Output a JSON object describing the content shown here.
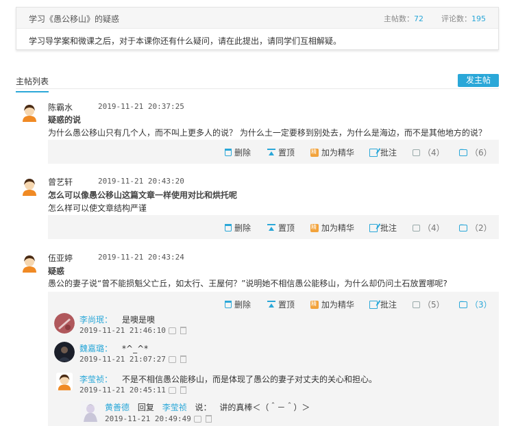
{
  "topic": {
    "title": "学习《愚公移山》的疑惑",
    "main_posts_label": "主帖数：",
    "main_posts_count": "72",
    "comments_label": "评论数：",
    "comments_count": "195",
    "description": "学习导学案和微课之后，对于本课你还有什么疑问，请在此提出，请同学们互相解疑。"
  },
  "list": {
    "tab_label": "主帖列表",
    "new_post_label": "发主帖"
  },
  "actions": {
    "delete": "删除",
    "pin": "置顶",
    "feature": "加为精华",
    "annotate": "批注"
  },
  "posts": [
    {
      "author": "陈霸水",
      "time": "2019-11-21 20:37:25",
      "title": "疑惑的说",
      "body": "为什么愚公移山只有几个人，而不叫上更多人的说？ 为什么土一定要移到别处去，为什么是海边，而不是其他地方的说？",
      "likes": "（4）",
      "replies": "（6）"
    },
    {
      "author": "曾艺轩",
      "time": "2019-11-21 20:43:20",
      "title": "怎么可以像愚公移山这篇文章一样使用对比和烘托呢",
      "body": "怎么样可以使文章结构严谨",
      "likes": "（4）",
      "replies": "（2）"
    },
    {
      "author": "伍亚婷",
      "time": "2019-11-21 20:43:24",
      "title": "疑惑",
      "body": "愚公的妻子说“曾不能损魁父亡丘，如太行、王屋何？”说明她不相信愚公能移山，为什么却仍问土石放置哪呢?",
      "likes": "（5）",
      "replies": "（3）"
    }
  ],
  "replies": [
    {
      "name": "李尚珉：",
      "text": "是噢是噢",
      "time": "2019-11-21 21:46:10"
    },
    {
      "name": "魏嘉璐：",
      "text": "*^_^*",
      "time": "2019-11-21 21:07:27"
    },
    {
      "name": "李莹祯：",
      "text": "不是不相信愚公能移山，而是体现了愚公的妻子对丈夫的关心和担心。",
      "time": "2019-11-21 20:45:11"
    }
  ],
  "nested_reply": {
    "name": "黄善德",
    "reply_word": "回复",
    "target": "李莹祯",
    "said": "说：",
    "text": "讲的真棒＜（＾－＾）＞",
    "time": "2019-11-21 20:49:49"
  },
  "colors": {
    "accent": "#2aa7d8",
    "action_bar": "#f4f4f4",
    "feature_icon": "#f2a33c"
  }
}
